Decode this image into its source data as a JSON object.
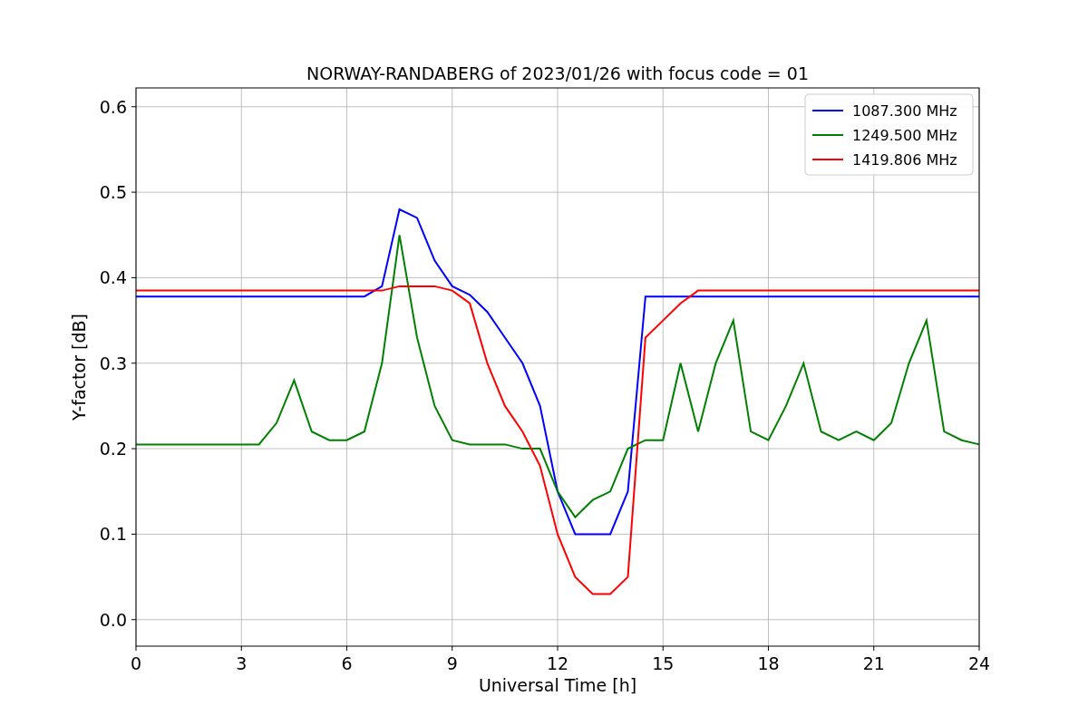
{
  "chart_data": {
    "type": "line",
    "title": "NORWAY-RANDABERG of 2023/01/26 with focus code = 01",
    "xlabel": "Universal Time [h]",
    "ylabel": "Y-factor [dB]",
    "x": [
      0,
      0.5,
      1,
      1.5,
      2,
      2.5,
      3,
      3.5,
      4,
      4.5,
      5,
      5.5,
      6,
      6.5,
      7,
      7.5,
      8,
      8.5,
      9,
      9.5,
      10,
      10.5,
      11,
      11.5,
      12,
      12.5,
      13,
      13.5,
      14,
      14.5,
      15,
      15.5,
      16,
      16.5,
      17,
      17.5,
      18,
      18.5,
      19,
      19.5,
      20,
      20.5,
      21,
      21.5,
      22,
      22.5,
      23,
      23.5,
      24
    ],
    "series": [
      {
        "name": "1087.300 MHz",
        "color": "#0000ff",
        "values": [
          0.378,
          0.378,
          0.378,
          0.378,
          0.378,
          0.378,
          0.378,
          0.378,
          0.378,
          0.378,
          0.378,
          0.378,
          0.378,
          0.378,
          0.39,
          0.48,
          0.47,
          0.42,
          0.39,
          0.38,
          0.36,
          0.33,
          0.3,
          0.25,
          0.15,
          0.1,
          0.1,
          0.1,
          0.15,
          0.378,
          0.378,
          0.378,
          0.378,
          0.378,
          0.378,
          0.378,
          0.378,
          0.378,
          0.378,
          0.378,
          0.378,
          0.378,
          0.378,
          0.378,
          0.378,
          0.378,
          0.378,
          0.378,
          0.378
        ]
      },
      {
        "name": "1249.500 MHz",
        "color": "#008000",
        "values": [
          0.205,
          0.205,
          0.205,
          0.205,
          0.205,
          0.205,
          0.205,
          0.205,
          0.23,
          0.28,
          0.22,
          0.21,
          0.21,
          0.22,
          0.3,
          0.45,
          0.33,
          0.25,
          0.21,
          0.205,
          0.205,
          0.205,
          0.2,
          0.2,
          0.15,
          0.12,
          0.14,
          0.15,
          0.2,
          0.21,
          0.21,
          0.3,
          0.22,
          0.3,
          0.35,
          0.22,
          0.21,
          0.25,
          0.3,
          0.22,
          0.21,
          0.22,
          0.21,
          0.23,
          0.3,
          0.35,
          0.22,
          0.21,
          0.205
        ]
      },
      {
        "name": "1419.806 MHz",
        "color": "#ff0000",
        "values": [
          0.385,
          0.385,
          0.385,
          0.385,
          0.385,
          0.385,
          0.385,
          0.385,
          0.385,
          0.385,
          0.385,
          0.385,
          0.385,
          0.385,
          0.385,
          0.39,
          0.39,
          0.39,
          0.385,
          0.37,
          0.3,
          0.25,
          0.22,
          0.18,
          0.1,
          0.05,
          0.03,
          0.03,
          0.05,
          0.33,
          0.35,
          0.37,
          0.385,
          0.385,
          0.385,
          0.385,
          0.385,
          0.385,
          0.385,
          0.385,
          0.385,
          0.385,
          0.385,
          0.385,
          0.385,
          0.385,
          0.385,
          0.385,
          0.385
        ]
      }
    ],
    "grid": true,
    "legend": true,
    "xlim": [
      0,
      24
    ],
    "ylim": [
      -0.031,
      0.622
    ],
    "xticks": [
      0,
      3,
      6,
      9,
      12,
      15,
      18,
      21,
      24
    ],
    "yticks": [
      {
        "value": 0,
        "label": "0.0"
      },
      {
        "value": 0.1,
        "label": "0.1"
      },
      {
        "value": 0.2,
        "label": "0.2"
      },
      {
        "value": 0.3,
        "label": "0.3"
      },
      {
        "value": 0.4,
        "label": "0.4"
      },
      {
        "value": 0.5,
        "label": "0.5"
      },
      {
        "value": 0.6,
        "label": "0.6"
      }
    ]
  }
}
